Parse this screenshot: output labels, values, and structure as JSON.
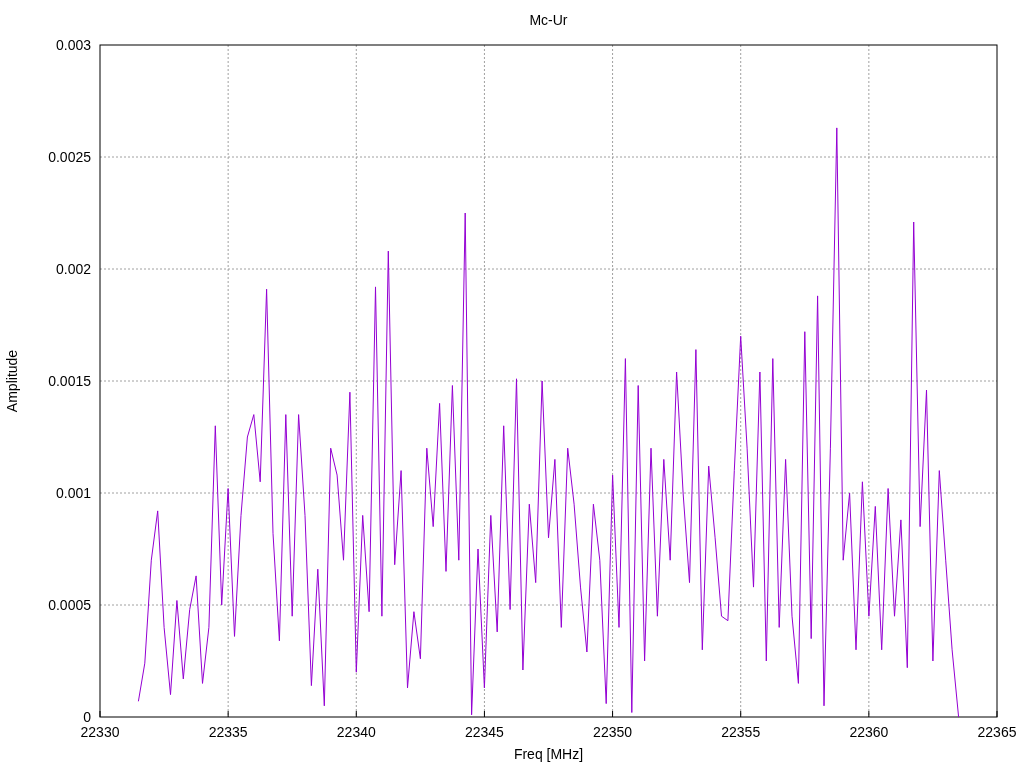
{
  "plot": {
    "chart_data": {
      "type": "line",
      "title": "Mc-Ur",
      "xlabel": "Freq [MHz]",
      "ylabel": "Amplitude",
      "grid": true,
      "xlim": [
        22330,
        22365
      ],
      "ylim": [
        0,
        0.003
      ],
      "xticks": [
        22330,
        22335,
        22340,
        22345,
        22350,
        22355,
        22360,
        22365
      ],
      "yticks": [
        {
          "value": 0,
          "label": "0"
        },
        {
          "value": 0.0005,
          "label": "0.0005"
        },
        {
          "value": 0.001,
          "label": "0.001"
        },
        {
          "value": 0.0015,
          "label": "0.0015"
        },
        {
          "value": 0.002,
          "label": "0.002"
        },
        {
          "value": 0.0025,
          "label": "0.0025"
        },
        {
          "value": 0.003,
          "label": "0.003"
        }
      ],
      "x": [
        22331.5,
        22331.75,
        22332,
        22332.25,
        22332.5,
        22332.75,
        22333,
        22333.25,
        22333.5,
        22333.75,
        22334,
        22334.25,
        22334.5,
        22334.75,
        22335,
        22335.25,
        22335.5,
        22335.75,
        22336,
        22336.25,
        22336.5,
        22336.75,
        22337,
        22337.25,
        22337.5,
        22337.75,
        22338,
        22338.25,
        22338.5,
        22338.75,
        22339,
        22339.25,
        22339.5,
        22339.75,
        22340,
        22340.25,
        22340.5,
        22340.75,
        22341,
        22341.25,
        22341.5,
        22341.75,
        22342,
        22342.25,
        22342.5,
        22342.75,
        22343,
        22343.25,
        22343.5,
        22343.75,
        22344,
        22344.25,
        22344.5,
        22344.75,
        22345,
        22345.25,
        22345.5,
        22345.75,
        22346,
        22346.25,
        22346.5,
        22346.75,
        22347,
        22347.25,
        22347.5,
        22347.75,
        22348,
        22348.25,
        22348.5,
        22348.75,
        22349,
        22349.25,
        22349.5,
        22349.75,
        22350,
        22350.25,
        22350.5,
        22350.75,
        22351,
        22351.25,
        22351.5,
        22351.75,
        22352,
        22352.25,
        22352.5,
        22352.75,
        22353,
        22353.25,
        22353.5,
        22353.75,
        22354,
        22354.25,
        22354.5,
        22354.75,
        22355,
        22355.25,
        22355.5,
        22355.75,
        22356,
        22356.25,
        22356.5,
        22356.75,
        22357,
        22357.25,
        22357.5,
        22357.75,
        22358,
        22358.25,
        22358.5,
        22358.75,
        22359,
        22359.25,
        22359.5,
        22359.75,
        22360,
        22360.25,
        22360.5,
        22360.75,
        22361,
        22361.25,
        22361.5,
        22361.75,
        22362,
        22362.25,
        22362.5,
        22362.75,
        22363,
        22363.25,
        22363.5
      ],
      "series": [
        {
          "color": "#9400d3",
          "values": [
            7e-05,
            0.00024,
            0.0007,
            0.00092,
            0.0004,
            0.0001,
            0.00052,
            0.00017,
            0.00048,
            0.00063,
            0.00015,
            0.0004,
            0.0013,
            0.0005,
            0.00102,
            0.00036,
            0.0009,
            0.00125,
            0.00135,
            0.00105,
            0.00191,
            0.00082,
            0.00034,
            0.00135,
            0.00045,
            0.00135,
            0.0009,
            0.00014,
            0.00066,
            5e-05,
            0.0012,
            0.00108,
            0.0007,
            0.00145,
            0.0002,
            0.0009,
            0.00047,
            0.00192,
            0.00045,
            0.00208,
            0.00068,
            0.0011,
            0.00013,
            0.00047,
            0.00026,
            0.0012,
            0.00085,
            0.0014,
            0.00065,
            0.00148,
            0.0007,
            0.00225,
            1e-05,
            0.00075,
            0.00013,
            0.0009,
            0.00038,
            0.0013,
            0.00048,
            0.00151,
            0.00021,
            0.00095,
            0.0006,
            0.0015,
            0.0008,
            0.00115,
            0.0004,
            0.0012,
            0.00095,
            0.00058,
            0.00029,
            0.00095,
            0.0007,
            6e-05,
            0.00108,
            0.0004,
            0.0016,
            2e-05,
            0.00148,
            0.00025,
            0.0012,
            0.00045,
            0.00115,
            0.0007,
            0.00154,
            0.001,
            0.0006,
            0.00164,
            0.0003,
            0.00112,
            0.0008,
            0.00045,
            0.00043,
            0.0011,
            0.0017,
            0.0012,
            0.00058,
            0.00154,
            0.00025,
            0.0016,
            0.0004,
            0.00115,
            0.00045,
            0.00015,
            0.00172,
            0.00035,
            0.00188,
            5e-05,
            0.0012,
            0.00263,
            0.0007,
            0.001,
            0.0003,
            0.00105,
            0.00045,
            0.00094,
            0.0003,
            0.00102,
            0.00045,
            0.00088,
            0.00022,
            0.00221,
            0.00085,
            0.00146,
            0.00025,
            0.0011,
            0.0007,
            0.0003,
            0
          ]
        }
      ]
    }
  }
}
